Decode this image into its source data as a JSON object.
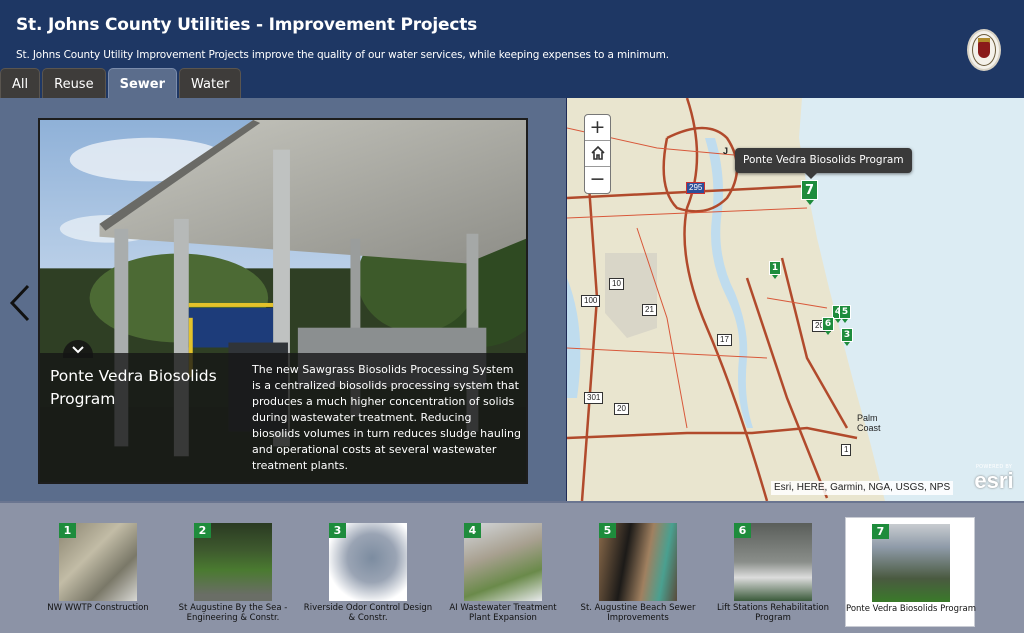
{
  "header": {
    "title": "St. Johns County Utilities - Improvement Projects",
    "subtitle": "St. Johns County Utility Improvement Projects improve the quality of our water services, while keeping expenses to a minimum.",
    "logo": "county-seal-icon"
  },
  "tabs": [
    {
      "label": "All",
      "active": false
    },
    {
      "label": "Reuse",
      "active": false
    },
    {
      "label": "Sewer",
      "active": true
    },
    {
      "label": "Water",
      "active": false
    }
  ],
  "feature": {
    "title": "Ponte Vedra Biosolids Program",
    "description": "The new Sawgrass Biosolids Processing System is a centralized biosolids processing system that produces a much higher concentration of solids during wastewater treatment. Reducing biosolids volumes in turn reduces sludge hauling and operational costs at several wastewater treatment plants.",
    "prev_icon": "chevron-left-icon",
    "toggle_icon": "chevron-down-icon"
  },
  "map": {
    "zoom_in": "+",
    "zoom_out": "−",
    "home_icon": "home-icon",
    "tooltip": "Ponte Vedra Biosolids Program",
    "labels": {
      "city1": "J",
      "city2_line1": "Palm",
      "city2_line2": "Coast"
    },
    "road_shields": [
      "295",
      "10",
      "100",
      "21",
      "17",
      "301",
      "20",
      "206",
      "1"
    ],
    "markers": [
      "1",
      "3",
      "4",
      "5",
      "6",
      "7"
    ],
    "attribution": "Esri, HERE, Garmin, NGA, USGS, NPS",
    "powered_by": "POWERED BY",
    "esri": "esri"
  },
  "projects": [
    {
      "num": "1",
      "label": "NW WWTP Construction",
      "active": false
    },
    {
      "num": "2",
      "label": "St Augustine By the Sea - Engineering & Constr.",
      "active": false
    },
    {
      "num": "3",
      "label": "Riverside Odor Control Design & Constr.",
      "active": false
    },
    {
      "num": "4",
      "label": "AI Wastewater Treatment Plant Expansion",
      "active": false
    },
    {
      "num": "5",
      "label": "St. Augustine Beach Sewer Improvements",
      "active": false
    },
    {
      "num": "6",
      "label": "Lift Stations Rehabilitation Program",
      "active": false
    },
    {
      "num": "7",
      "label": "Ponte Vedra Biosolids Program",
      "active": true
    }
  ]
}
